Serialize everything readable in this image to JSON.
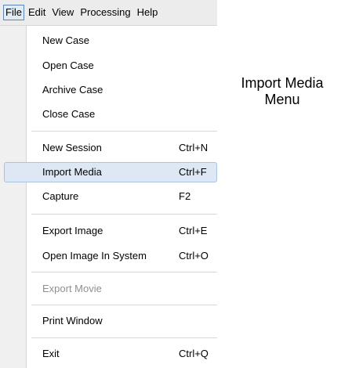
{
  "menubar": {
    "items": [
      "File",
      "Edit",
      "View",
      "Processing",
      "Help"
    ],
    "active": "File"
  },
  "file_menu": {
    "new_case": "New Case",
    "open_case": "Open Case",
    "archive_case": "Archive Case",
    "close_case": "Close Case",
    "new_session": {
      "label": "New Session",
      "shortcut": "Ctrl+N"
    },
    "import_media": {
      "label": "Import Media",
      "shortcut": "Ctrl+F"
    },
    "capture": {
      "label": "Capture",
      "shortcut": "F2"
    },
    "export_image": {
      "label": "Export Image",
      "shortcut": "Ctrl+E"
    },
    "open_image_in_system": {
      "label": "Open Image In System",
      "shortcut": "Ctrl+O"
    },
    "export_movie": "Export Movie",
    "print_window": "Print Window",
    "exit": {
      "label": "Exit",
      "shortcut": "Ctrl+Q"
    }
  },
  "caption": {
    "line1": "Import Media",
    "line2": "Menu"
  },
  "colors": {
    "highlight_fill": "#dde8f4",
    "highlight_border": "#a9c3de",
    "disabled_text": "#8f8f8f",
    "menubar_bg": "#ececec"
  }
}
